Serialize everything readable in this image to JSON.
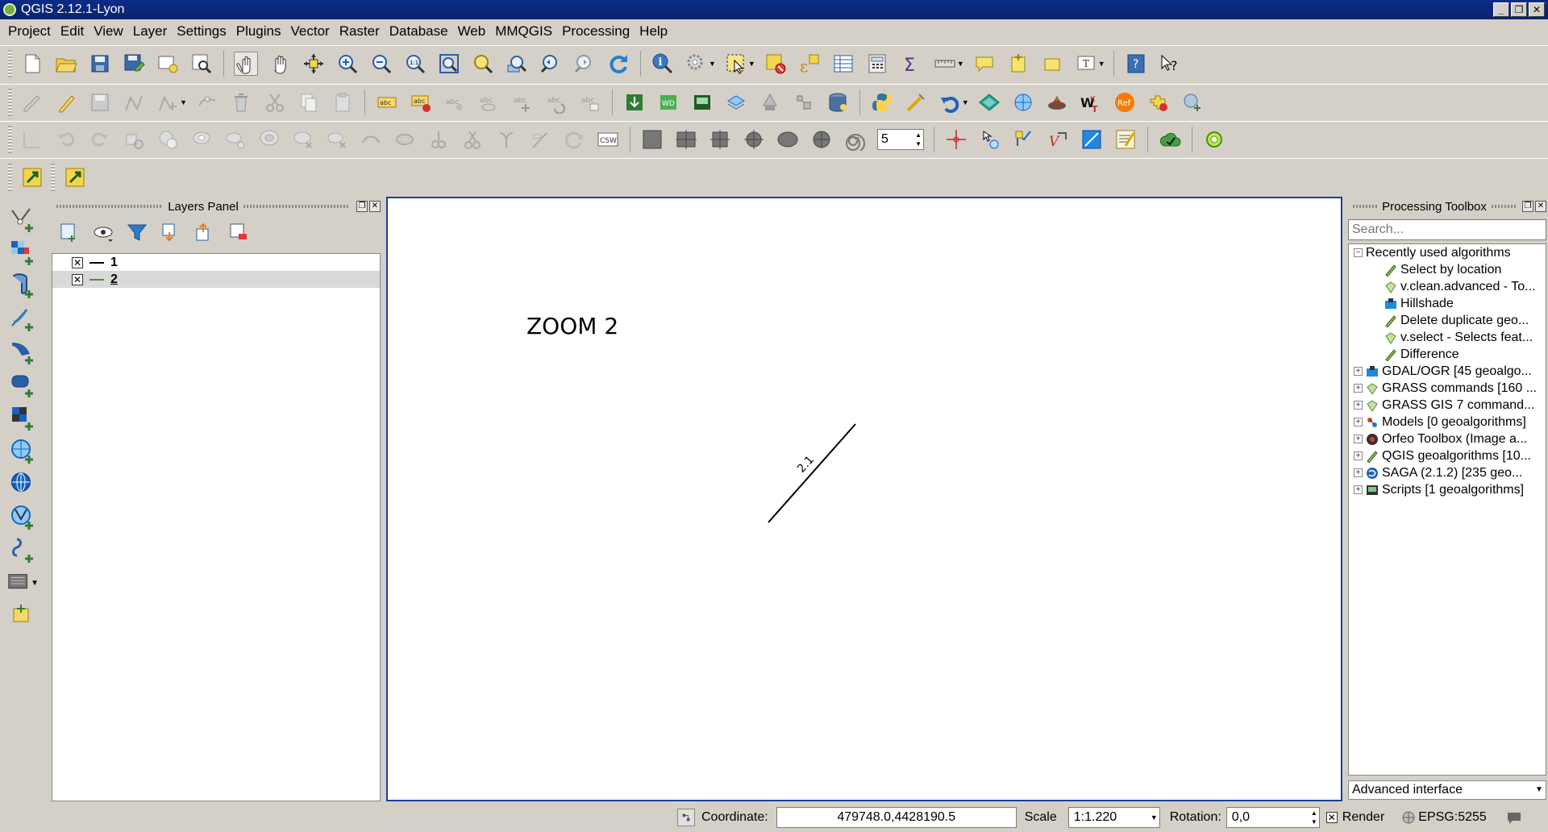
{
  "window": {
    "title": "QGIS 2.12.1-Lyon"
  },
  "menu": [
    "Project",
    "Edit",
    "View",
    "Layer",
    "Settings",
    "Plugins",
    "Vector",
    "Raster",
    "Database",
    "Web",
    "MMQGIS",
    "Processing",
    "Help"
  ],
  "toolbar": {
    "csw_label": "CSW",
    "buffer_value": "5"
  },
  "layers_panel": {
    "title": "Layers Panel",
    "layers": [
      {
        "name": "1",
        "checked": "✕",
        "color": "#000000"
      },
      {
        "name": "2",
        "checked": "✕",
        "color": "#4a8f3a"
      }
    ]
  },
  "map": {
    "label": "ZOOM 2",
    "line_label": "2.1"
  },
  "processing": {
    "title": "Processing Toolbox",
    "search_placeholder": "Search...",
    "recent_group": "Recently used algorithms",
    "recent": [
      "Select by location",
      "v.clean.advanced - To...",
      "Hillshade",
      "Delete duplicate geo...",
      "v.select - Selects feat...",
      "Difference"
    ],
    "providers": [
      "GDAL/OGR [45 geoalgo...",
      "GRASS commands [160 ...",
      "GRASS GIS 7 command...",
      "Models [0 geoalgorithms]",
      "Orfeo Toolbox (Image a...",
      "QGIS geoalgorithms [10...",
      "SAGA (2.1.2) [235 geo...",
      "Scripts [1 geoalgorithms]"
    ],
    "advanced": "Advanced interface"
  },
  "status": {
    "coordinate_label": "Coordinate:",
    "coordinate_value": "479748.0,4428190.5",
    "scale_label": "Scale",
    "scale_value": "1:1.220",
    "rotation_label": "Rotation:",
    "rotation_value": "0,0",
    "render_label": "Render",
    "render_checked": "✕",
    "crs": "EPSG:5255"
  }
}
